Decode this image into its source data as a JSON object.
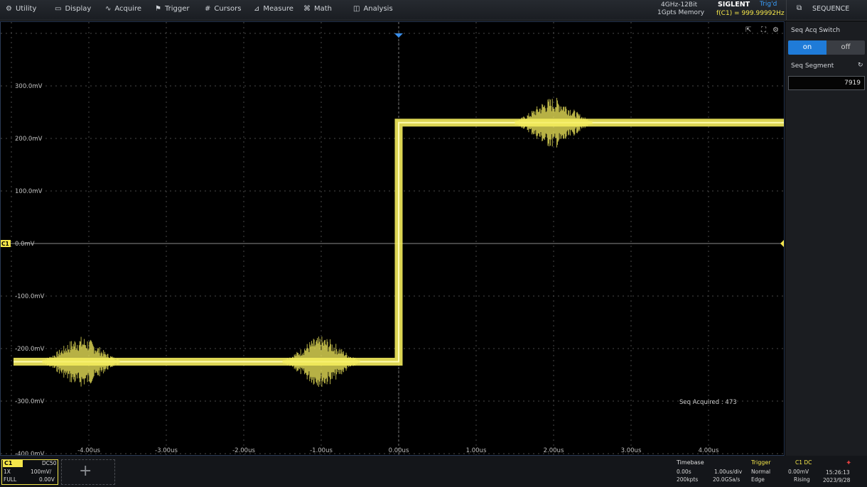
{
  "menu": [
    {
      "label": "Utility",
      "icon": "gear-icon",
      "glyph": "⚙"
    },
    {
      "label": "Display",
      "icon": "display-icon",
      "glyph": "▭"
    },
    {
      "label": "Acquire",
      "icon": "acquire-icon",
      "glyph": "∿"
    },
    {
      "label": "Trigger",
      "icon": "trigger-icon",
      "glyph": "⚑"
    },
    {
      "label": "Cursors",
      "icon": "cursors-icon",
      "glyph": "#"
    },
    {
      "label": "Measure",
      "icon": "measure-icon",
      "glyph": "⊿"
    },
    {
      "label": "Math",
      "icon": "math-icon",
      "glyph": "⌘"
    },
    {
      "label": "Analysis",
      "icon": "analysis-icon",
      "glyph": "◫"
    }
  ],
  "device": {
    "spec_line1": "4GHz-12Bit",
    "spec_line2": "1Gpts Memory",
    "brand": "SIGLENT",
    "trig_status": "Trig'd",
    "freq": "f(C1) = 999.99992Hz"
  },
  "sequence_title": "SEQUENCE",
  "panel": {
    "seq_acq_switch_label": "Seq Acq Switch",
    "on_label": "on",
    "off_label": "off",
    "seq_segment_label": "Seq Segment",
    "seq_segment_value": "7919"
  },
  "screen": {
    "seq_acquired": "Seq Acquired : 473",
    "channel_marker": "C1"
  },
  "axes": {
    "y_ticks": [
      "300.0mV",
      "200.0mV",
      "100.0mV",
      "0.0mV",
      "-100.0mV",
      "-200.0mV",
      "-300.0mV",
      "-400.0mV"
    ],
    "x_ticks": [
      "-4.00us",
      "-3.00us",
      "-2.00us",
      "-1.00us",
      "0.00us",
      "1.00us",
      "2.00us",
      "3.00us",
      "4.00us"
    ]
  },
  "channel": {
    "name": "C1",
    "coupling": "DC50",
    "probe": "1X",
    "scale": "100mV/",
    "bandwidth": "FULL",
    "offset": "0.00V"
  },
  "timebase": {
    "label": "Timebase",
    "delay": "0.00s",
    "scale": "1.00us/div",
    "points": "200kpts",
    "rate": "20.0GSa/s"
  },
  "trigger": {
    "label": "Trigger",
    "source": "C1 DC",
    "mode": "Normal",
    "level": "0.00mV",
    "type": "Edge",
    "slope": "Rising"
  },
  "clock": {
    "time": "15:26:13",
    "date": "2023/9/28"
  },
  "colors": {
    "trace": "#f4ec5c",
    "accent": "#1f7bd8",
    "grid": "#4a4a4a"
  },
  "chart_data": {
    "type": "line",
    "x_unit": "us",
    "y_unit": "mV",
    "xlim": [
      -5,
      5
    ],
    "ylim": [
      -400,
      300
    ],
    "series": [
      {
        "x": [
          -5,
          0,
          0,
          5
        ],
        "y": [
          -225,
          -225,
          230,
          230
        ]
      }
    ],
    "noise_bursts_center_us": [
      -4.1,
      -1.0,
      2.0
    ]
  }
}
